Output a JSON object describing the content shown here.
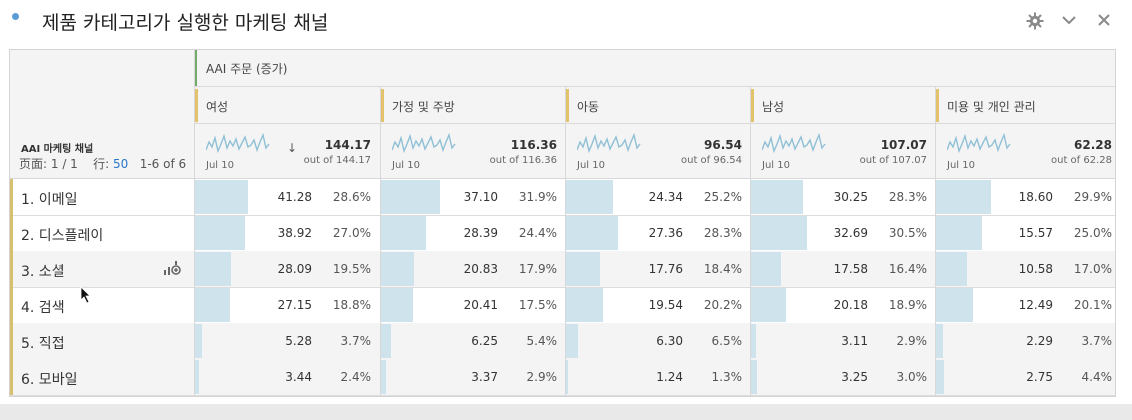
{
  "header": {
    "title": "제품 카테고리가 실행한 마케팅 채널",
    "icons": [
      "gear-icon",
      "chevron-down-icon",
      "close-icon"
    ]
  },
  "table": {
    "metric_label": "AAI 주문 (증가)",
    "dimension_label": "AAI 마케팅 채널",
    "pager": {
      "page_label": "页面:",
      "page_value": "1 / 1",
      "rows_label": "行:",
      "rows_value": "50",
      "range_text": "1-6 of 6"
    },
    "columns": [
      {
        "label": "여성",
        "total": "144.17",
        "total_of": "out of 144.17",
        "date": "Jul 10"
      },
      {
        "label": "가정 및 주방",
        "total": "116.36",
        "total_of": "out of 116.36",
        "date": "Jul 10"
      },
      {
        "label": "아동",
        "total": "96.54",
        "total_of": "out of 96.54",
        "date": "Jul 10"
      },
      {
        "label": "남성",
        "total": "107.07",
        "total_of": "out of 107.07",
        "date": "Jul 10"
      },
      {
        "label": "미용 및 개인 관리",
        "total": "62.28",
        "total_of": "out of 62.28",
        "date": "Jul 10"
      }
    ],
    "rows": [
      {
        "label": "1. 이메일",
        "cells": [
          {
            "v": "41.28",
            "p": "28.6%",
            "f": 0.286
          },
          {
            "v": "37.10",
            "p": "31.9%",
            "f": 0.319
          },
          {
            "v": "24.34",
            "p": "25.2%",
            "f": 0.252
          },
          {
            "v": "30.25",
            "p": "28.3%",
            "f": 0.283
          },
          {
            "v": "18.60",
            "p": "29.9%",
            "f": 0.299
          }
        ]
      },
      {
        "label": "2. 디스플레이",
        "cells": [
          {
            "v": "38.92",
            "p": "27.0%",
            "f": 0.27
          },
          {
            "v": "28.39",
            "p": "24.4%",
            "f": 0.244
          },
          {
            "v": "27.36",
            "p": "28.3%",
            "f": 0.283
          },
          {
            "v": "32.69",
            "p": "30.5%",
            "f": 0.305
          },
          {
            "v": "15.57",
            "p": "25.0%",
            "f": 0.25
          }
        ]
      },
      {
        "label": "3. 소셜",
        "cells": [
          {
            "v": "28.09",
            "p": "19.5%",
            "f": 0.195
          },
          {
            "v": "20.83",
            "p": "17.9%",
            "f": 0.179
          },
          {
            "v": "17.76",
            "p": "18.4%",
            "f": 0.184
          },
          {
            "v": "17.58",
            "p": "16.4%",
            "f": 0.164
          },
          {
            "v": "10.58",
            "p": "17.0%",
            "f": 0.17
          }
        ]
      },
      {
        "label": "4. 검색",
        "cells": [
          {
            "v": "27.15",
            "p": "18.8%",
            "f": 0.188
          },
          {
            "v": "20.41",
            "p": "17.5%",
            "f": 0.175
          },
          {
            "v": "19.54",
            "p": "20.2%",
            "f": 0.202
          },
          {
            "v": "20.18",
            "p": "18.9%",
            "f": 0.189
          },
          {
            "v": "12.49",
            "p": "20.1%",
            "f": 0.201
          }
        ]
      },
      {
        "label": "5. 직접",
        "cells": [
          {
            "v": "5.28",
            "p": "3.7%",
            "f": 0.037
          },
          {
            "v": "6.25",
            "p": "5.4%",
            "f": 0.054
          },
          {
            "v": "6.30",
            "p": "6.5%",
            "f": 0.065
          },
          {
            "v": "3.11",
            "p": "2.9%",
            "f": 0.029
          },
          {
            "v": "2.29",
            "p": "3.7%",
            "f": 0.037
          }
        ]
      },
      {
        "label": "6. 모바일",
        "cells": [
          {
            "v": "3.44",
            "p": "2.4%",
            "f": 0.024
          },
          {
            "v": "3.37",
            "p": "2.9%",
            "f": 0.029
          },
          {
            "v": "1.24",
            "p": "1.3%",
            "f": 0.013
          },
          {
            "v": "3.25",
            "p": "3.0%",
            "f": 0.03
          },
          {
            "v": "2.75",
            "p": "4.4%",
            "f": 0.044
          }
        ]
      }
    ]
  },
  "colors": {
    "fill": "#cfe3ec",
    "accent_green": "#73a96b",
    "accent_gold": "#e2c26a",
    "link": "#2a77c9"
  }
}
